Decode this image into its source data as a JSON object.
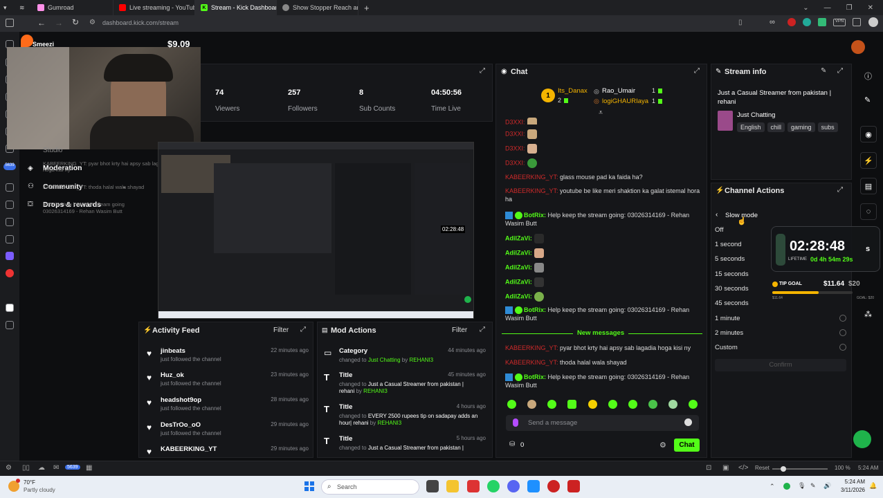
{
  "browser": {
    "tabs": [
      {
        "label": "Gumroad",
        "color": "#ff90e8"
      },
      {
        "label": "Live streaming - YouTube S",
        "color": "#ff0000"
      },
      {
        "label": "Stream - Kick Dashboard",
        "color": "#53fc18"
      },
      {
        "label": "Show Stopper Reach an av...",
        "color": "#888888"
      }
    ],
    "new_tab": "+",
    "url": "dashboard.kick.com/stream"
  },
  "overlay": {
    "streamer_name": "Smeezi",
    "earnings": "$9.09",
    "timer": "02:28:48",
    "timer_suffix": "s",
    "lifetime_label": "LIFETIME",
    "lifetime_value": "0d 4h 54m 29s",
    "tip_goal_label": "TIP GOAL",
    "tip_current": "$11.64",
    "tip_target": "$20",
    "tip_progress": 0.58,
    "tip_raised": "$11.64",
    "tip_goal_small": "GOAL: $20"
  },
  "sidebar_menu": [
    {
      "label": "Studio"
    },
    {
      "label": "Moderation"
    },
    {
      "label": "Community"
    },
    {
      "label": "Drops & rewards"
    }
  ],
  "overlay_chat_ghost": [
    "KABEERKING_YT: pyar bhot krty hai apsy sab lagada",
    "hoga kisi ny",
    "KABEERKING_YT: thoda halal wala shayad",
    "BotRix: Help keep the stream going",
    "03026314169 - Rehan Wasim Butt",
    "03026314169 - Rehan Wasim Butt"
  ],
  "stats": [
    {
      "value": "74",
      "label": "Viewers"
    },
    {
      "value": "257",
      "label": "Followers"
    },
    {
      "value": "8",
      "label": "Sub Counts"
    },
    {
      "value": "04:50:56",
      "label": "Time Live"
    }
  ],
  "preview": {
    "mini_timer": "02:28:48"
  },
  "chat": {
    "title": "Chat",
    "leaderboard": [
      {
        "name": "Its_Danax",
        "count": "2",
        "rank": "1"
      },
      {
        "name": "Rao_Umair",
        "count": "1"
      },
      {
        "name": "logiGHAURIaya",
        "count": "1"
      }
    ],
    "messages": [
      {
        "user": "D3XXI:",
        "text": ""
      },
      {
        "user": "D3XXI:",
        "text": ""
      },
      {
        "user": "D3XXI:",
        "text": ""
      },
      {
        "user": "D3XXI:",
        "text": ""
      },
      {
        "user": "KABEERKING_YT:",
        "text": "glass mouse pad ka faida ha?"
      },
      {
        "user": "KABEERKING_YT:",
        "text": "youtube be like meri shaktion ka galat istemal hora ha"
      },
      {
        "user": "BotRix:",
        "text": "Help keep the stream going: 03026314169 - Rehan Wasim Butt"
      },
      {
        "user": "AdilZaVi:",
        "text": ""
      },
      {
        "user": "AdilZaVi:",
        "text": ""
      },
      {
        "user": "AdilZaVi:",
        "text": ""
      },
      {
        "user": "AdilZaVi:",
        "text": ""
      },
      {
        "user": "AdilZaVi:",
        "text": ""
      },
      {
        "user": "BotRix:",
        "text": "Help keep the stream going: 03026314169 - Rehan Wasim Butt"
      }
    ],
    "new_messages_label": "New messages",
    "new_messages": [
      {
        "user": "KABEERKING_YT:",
        "text": "pyar bhot krty hai apsy sab lagadia hoga kisi ny"
      },
      {
        "user": "KABEERKING_YT:",
        "text": "thoda halal wala shayad"
      },
      {
        "user": "BotRix:",
        "text": "Help keep the stream going: 03026314169 - Rehan Wasim Butt"
      }
    ],
    "input_placeholder": "Send a message",
    "points": "0",
    "send_label": "Chat"
  },
  "stream_info": {
    "title": "Stream info",
    "stream_title": "Just a Casual Streamer from pakistan | rehani",
    "category": "Just Chatting",
    "tags": [
      "English",
      "chill",
      "gaming",
      "subs"
    ]
  },
  "channel_actions": {
    "title": "Channel Actions",
    "back_label": "Slow mode",
    "options": [
      "Off",
      "1 second",
      "5 seconds",
      "15 seconds",
      "30 seconds",
      "45 seconds",
      "1 minute",
      "2 minutes",
      "Custom"
    ],
    "confirm_label": "Confirm"
  },
  "activity_feed": {
    "title": "Activity Feed",
    "filter_label": "Filter",
    "items": [
      {
        "name": "jinbeats",
        "sub": "just followed the channel",
        "time": "22 minutes ago"
      },
      {
        "name": "Huz_ok",
        "sub": "just followed the channel",
        "time": "23 minutes ago"
      },
      {
        "name": "headshot9op",
        "sub": "just followed the channel",
        "time": "28 minutes ago"
      },
      {
        "name": "DesTrOo_oO",
        "sub": "just followed the channel",
        "time": "29 minutes ago"
      },
      {
        "name": "KABEERKING_YT",
        "sub": "",
        "time": "29 minutes ago"
      }
    ]
  },
  "mod_actions": {
    "title": "Mod Actions",
    "filter_label": "Filter",
    "items": [
      {
        "type": "Category",
        "prefix": "changed to",
        "value": "Just Chatting",
        "by": "by",
        "user": "REHANI3",
        "time": "44 minutes ago"
      },
      {
        "type": "Title",
        "prefix": "changed to",
        "value": "Just a Casual Streamer from pakistan | rehani",
        "by": "by",
        "user": "REHANI3",
        "time": "45 minutes ago"
      },
      {
        "type": "Title",
        "prefix": "changed to",
        "value": "EVERY 2500 rupees tip on sadapay adds an hour| rehani",
        "by": "by",
        "user": "REHANI3",
        "time": "4 hours ago"
      },
      {
        "type": "Title",
        "prefix": "changed to",
        "value": "Just a Casual Streamer from pakistan |",
        "by": "",
        "user": "",
        "time": "5 hours ago"
      }
    ]
  },
  "statusbar": {
    "reset": "Reset",
    "zoom": "100 %",
    "time": "5:24 AM",
    "badge": "5639"
  },
  "taskbar": {
    "weather_temp": "70°F",
    "weather_desc": "Partly cloudy",
    "search_placeholder": "Search",
    "clock_time": "5:24 AM",
    "clock_date": "3/11/2026"
  },
  "colors": {
    "kick_green": "#53fc18",
    "panel_bg": "#151619",
    "page_bg": "#0d0e10",
    "username_red": "#d02a2a"
  }
}
